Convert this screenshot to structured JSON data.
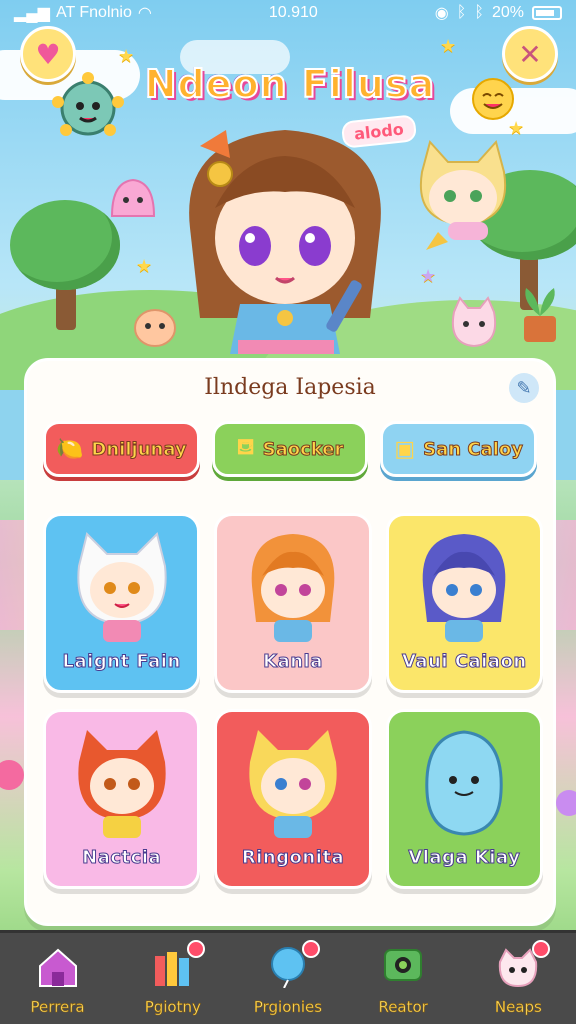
{
  "status_bar": {
    "carrier": "AT Fnolnio",
    "time": "10.910",
    "battery": "20%"
  },
  "header": {
    "title": "Ndeon Filusa",
    "subtitle": "alodo"
  },
  "panel": {
    "title": "Ilndega Iapesia",
    "filters": [
      {
        "label": "Dniljunay",
        "icon": "lemon-icon"
      },
      {
        "label": "Saocker",
        "icon": "pot-icon"
      },
      {
        "label": "San Caloy",
        "icon": "bucket-icon"
      }
    ],
    "characters": [
      {
        "name": "Laignt Fain",
        "bg": "#5ec2f2"
      },
      {
        "name": "Kanla",
        "bg": "#fbc7c7"
      },
      {
        "name": "Vaui Caiaon",
        "bg": "#fbe66a"
      },
      {
        "name": "Nactcia",
        "bg": "#f9b9e6"
      },
      {
        "name": "Ringonita",
        "bg": "#f25c5c"
      },
      {
        "name": "Vlaga Kiay",
        "bg": "#8bd15b"
      }
    ]
  },
  "nav": [
    {
      "label": "Perrera",
      "icon": "home-icon",
      "badge": false
    },
    {
      "label": "Pgiotny",
      "icon": "books-icon",
      "badge": true
    },
    {
      "label": "Prgionies",
      "icon": "balloon-icon",
      "badge": true
    },
    {
      "label": "Reator",
      "icon": "monitor-icon",
      "badge": false
    },
    {
      "label": "Neaps",
      "icon": "cat-face-icon",
      "badge": true
    }
  ],
  "colors": {
    "accent": "#ffb22e",
    "pink": "#e7489a",
    "nav_bg": "#4a4a4a"
  }
}
